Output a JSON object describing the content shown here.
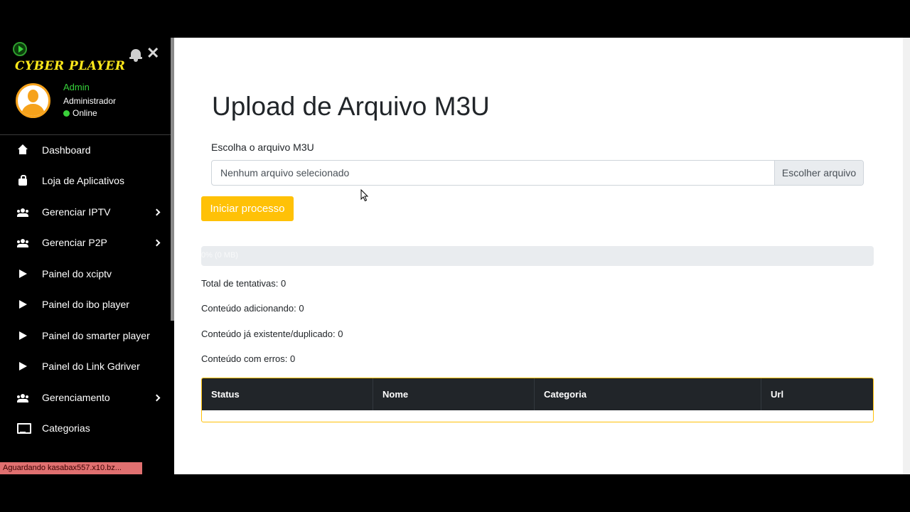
{
  "brand": {
    "name": "CYBER PLAYER"
  },
  "user": {
    "name": "Admin",
    "role": "Administrador",
    "status": "Online"
  },
  "sidebar": {
    "items": [
      {
        "label": "Dashboard",
        "icon": "home-icon",
        "submenu": false
      },
      {
        "label": "Loja de Aplicativos",
        "icon": "shopping-bag-icon",
        "submenu": false
      },
      {
        "label": "Gerenciar IPTV",
        "icon": "users-icon",
        "submenu": true
      },
      {
        "label": "Gerenciar P2P",
        "icon": "users-icon",
        "submenu": true
      },
      {
        "label": "Painel do xciptv",
        "icon": "play-icon",
        "submenu": false
      },
      {
        "label": "Painel do ibo player",
        "icon": "play-icon",
        "submenu": false
      },
      {
        "label": "Painel do smarter player",
        "icon": "play-icon",
        "submenu": false
      },
      {
        "label": "Painel do Link Gdriver",
        "icon": "play-icon",
        "submenu": false
      },
      {
        "label": "Gerenciamento",
        "icon": "users-icon",
        "submenu": true
      },
      {
        "label": "Categorias",
        "icon": "monitor-icon",
        "submenu": false
      }
    ]
  },
  "browser_status": "Aguardando kasabax557.x10.bz...",
  "main": {
    "title": "Upload de Arquivo M3U",
    "file_label": "Escolha o arquivo M3U",
    "file_placeholder": "Nenhum arquivo selecionado",
    "browse_label": "Escolher arquivo",
    "start_button": "Iniciar processo",
    "progress": {
      "value": 0,
      "text": "0% (0 MB)"
    },
    "stats": [
      "Total de tentativas: 0",
      "Conteúdo adicionando: 0",
      "Conteúdo já existente/duplicado: 0",
      "Conteúdo com erros: 0"
    ],
    "table": {
      "columns": [
        "Status",
        "Nome",
        "Categoria",
        "Url"
      ]
    }
  },
  "colors": {
    "accent": "#ffc107",
    "brand_yellow": "#ffe81a",
    "online_green": "#3ad13a",
    "avatar_orange": "#f6a21b"
  }
}
